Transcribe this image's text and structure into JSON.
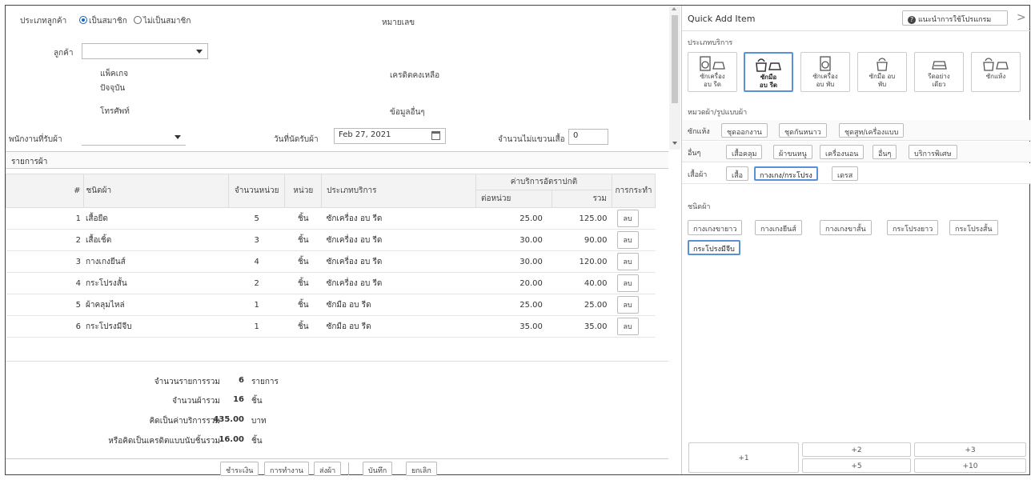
{
  "header": {
    "customer_type_label": "ประเภทลูกค้า",
    "member_option": "เป็นสมาชิก",
    "non_member_option": "ไม่เป็นสมาชิก",
    "number_label": "หมายเลข",
    "customer_label": "ลูกค้า",
    "package_label": "แพ็คเกจ",
    "current_label": "ปัจจุบัน",
    "credit_label": "เครดิตคงเหลือ",
    "phone_label": "โทรศัพท์",
    "other_info_label": "ข้อมูลอื่นๆ",
    "staff_label": "พนักงานที่รับผ้า",
    "pickup_date_label": "วันที่นัดรับผ้า",
    "pickup_date_value": "Feb 27, 2021",
    "no_hanger_label": "จำนวนไม่แขวนเสื้อ",
    "no_hanger_value": "0"
  },
  "items_section": {
    "title": "รายการผ้า",
    "columns": {
      "num": "#",
      "name": "ชนิดผ้า",
      "qty": "จำนวนหน่วย",
      "unit": "หน่วย",
      "service": "ประเภทบริการ",
      "rate_group": "ค่าบริการอัตราปกติ",
      "per_unit": "ต่อหน่วย",
      "total": "รวม",
      "action": "การกระทำ"
    },
    "rows": [
      {
        "num": "1",
        "name": "เสื้อยืด",
        "qty": "5",
        "unit": "ชิ้น",
        "service": "ซักเครื่อง อบ รีด",
        "price": "25.00",
        "total": "125.00",
        "action": "ลบ"
      },
      {
        "num": "2",
        "name": "เสื้อเชิ้ต",
        "qty": "3",
        "unit": "ชิ้น",
        "service": "ซักเครื่อง อบ รีด",
        "price": "30.00",
        "total": "90.00",
        "action": "ลบ"
      },
      {
        "num": "3",
        "name": "กางเกงยีนส์",
        "qty": "4",
        "unit": "ชิ้น",
        "service": "ซักเครื่อง อบ รีด",
        "price": "30.00",
        "total": "120.00",
        "action": "ลบ"
      },
      {
        "num": "4",
        "name": "กระโปรงสั้น",
        "qty": "2",
        "unit": "ชิ้น",
        "service": "ซักเครื่อง อบ รีด",
        "price": "20.00",
        "total": "40.00",
        "action": "ลบ"
      },
      {
        "num": "5",
        "name": "ผ้าคลุมไหล่",
        "qty": "1",
        "unit": "ชิ้น",
        "service": "ซักมือ อบ รีด",
        "price": "25.00",
        "total": "25.00",
        "action": "ลบ"
      },
      {
        "num": "6",
        "name": "กระโปรงมีจีบ",
        "qty": "1",
        "unit": "ชิ้น",
        "service": "ซักมือ อบ รีด",
        "price": "35.00",
        "total": "35.00",
        "action": "ลบ"
      }
    ]
  },
  "summary": {
    "total_items_label": "จำนวนรายการรวม",
    "total_items_value": "6",
    "total_items_unit": "รายการ",
    "total_pieces_label": "จำนวนผ้ารวม",
    "total_pieces_value": "16",
    "total_pieces_unit": "ชิ้น",
    "total_cost_label": "คิดเป็นค่าบริการรวม",
    "total_cost_value": "435.00",
    "total_cost_unit": "บาท",
    "credit_total_label": "หรือคิดเป็นเครดิตแบบนับชิ้นรวม",
    "credit_total_value": "16.00",
    "credit_total_unit": "ชิ้น"
  },
  "footer": {
    "pay": "ชำระเงิน",
    "work": "การทำงาน",
    "deliver": "ส่งผ้า",
    "save": "บันทึก",
    "cancel": "ยกเลิก"
  },
  "quick_add": {
    "title": "Quick Add Item",
    "help": "แนะนำการใช้โปรแกรม",
    "service_label": "ประเภทบริการ",
    "services": [
      {
        "line1": "ซักเครื่อง",
        "line2": "อบ รีด"
      },
      {
        "line1": "ซักมือ",
        "line2": "อบ รีด"
      },
      {
        "line1": "ซักเครื่อง",
        "line2": "อบ พับ"
      },
      {
        "line1": "ซักมือ อบ",
        "line2": "พับ"
      },
      {
        "line1": "รีดอย่าง",
        "line2": "เดียว"
      },
      {
        "line1": "ซักแห้ง",
        "line2": ""
      }
    ],
    "category_label": "หมวดผ้า/รูปแบบผ้า",
    "cat_rows": [
      {
        "label": "ซักแห้ง",
        "chips": [
          "ชุดออกงาน",
          "ชุดกันหนาว",
          "ชุดสูท/เครื่องแบบ"
        ]
      },
      {
        "label": "อื่นๆ",
        "chips": [
          "เสื้อคลุม",
          "ผ้าขนหนู",
          "เครื่องนอน",
          "อื่นๆ",
          "บริการพิเศษ"
        ]
      },
      {
        "label": "เสื้อผ้า",
        "chips": [
          "เสื้อ",
          "กางเกง/กระโปรง",
          "เดรส"
        ]
      }
    ],
    "kind_label": "ชนิดผ้า",
    "kinds": [
      "กางเกงขายาว",
      "กางเกงยีนส์",
      "กางเกงขาสั้น",
      "กระโปรงยาว",
      "กระโปรงสั้น",
      "กระโปรงมีจีบ"
    ],
    "qty_buttons": {
      "p1": "+1",
      "p2": "+2",
      "p3": "+3",
      "p5": "+5",
      "p10": "+10"
    }
  }
}
